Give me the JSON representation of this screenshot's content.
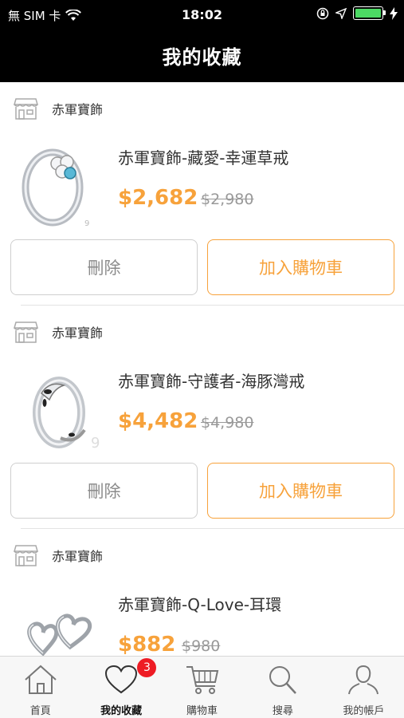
{
  "status_bar": {
    "carrier": "無 SIM 卡",
    "time": "18:02"
  },
  "nav": {
    "title": "我的收藏"
  },
  "favorites": [
    {
      "store": "赤軍寶飾",
      "name": "赤軍寶飾-藏愛-幸運草戒",
      "price": "$2,682",
      "original_price": "$2,980",
      "delete_label": "刪除",
      "add_cart_label": "加入購物車"
    },
    {
      "store": "赤軍寶飾",
      "name": "赤軍寶飾-守護者-海豚灣戒",
      "price": "$4,482",
      "original_price": "$4,980",
      "delete_label": "刪除",
      "add_cart_label": "加入購物車"
    },
    {
      "store": "赤軍寶飾",
      "name": "赤軍寶飾-Q-Love-耳環",
      "price": "$882",
      "original_price": "$980"
    }
  ],
  "tab_bar": {
    "items": [
      {
        "label": "首頁",
        "icon": "home-icon"
      },
      {
        "label": "我的收藏",
        "icon": "heart-icon",
        "badge": "3"
      },
      {
        "label": "購物車",
        "icon": "cart-icon"
      },
      {
        "label": "搜尋",
        "icon": "search-icon"
      },
      {
        "label": "我的帳戶",
        "icon": "person-icon"
      }
    ]
  },
  "colors": {
    "accent": "#f7a23b",
    "badge": "#ee1c25",
    "battery": "#4cd964"
  }
}
